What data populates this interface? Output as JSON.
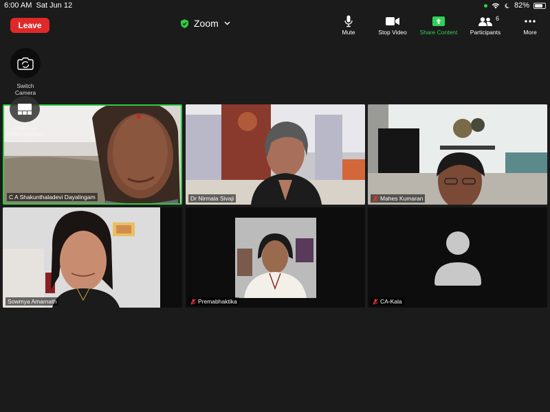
{
  "status": {
    "time": "6:00 AM",
    "date": "Sat Jun 12",
    "battery": "82%",
    "battery_level": 0.82
  },
  "header": {
    "leave_label": "Leave",
    "app_title": "Zoom"
  },
  "toolbar": {
    "mute_label": "Mute",
    "stop_video_label": "Stop Video",
    "share_label": "Share Content",
    "participants_label": "Participants",
    "participants_count": "6",
    "more_label": "More"
  },
  "side": {
    "switch_camera_label": "Switch Camera",
    "active_speaker_label": "Switch to Active Speaker"
  },
  "participants": [
    {
      "name": "C A Shakunthaladevi Dayalingam"
    },
    {
      "name": "Dr Nirmala Sivaji"
    },
    {
      "name": "Mahes Kumaran"
    },
    {
      "name": "Sowmya Amarnath"
    },
    {
      "name": "Premabhaktika"
    },
    {
      "name": "CA-Kala"
    }
  ],
  "colors": {
    "leave": "#e02828",
    "share": "#30d158",
    "active_border": "#2ecc40",
    "background": "#1b1b1b"
  }
}
